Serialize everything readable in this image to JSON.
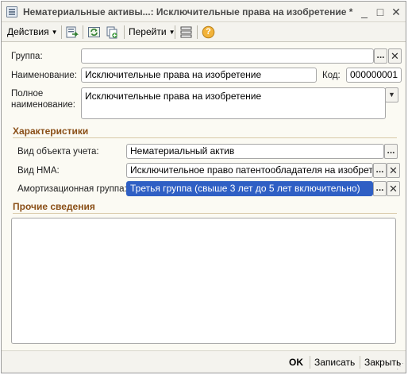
{
  "window": {
    "title": "Нематериальные активы...: Исключительные права на изобретение *",
    "minimize": "_",
    "maximize": "□",
    "close": "✕"
  },
  "toolbar": {
    "actions_label": "Действия",
    "goto_label": "Перейти",
    "help_label": "?"
  },
  "form": {
    "group_label": "Группа:",
    "group_value": "",
    "name_label": "Наименование:",
    "name_value": "Исключительные права на изобретение",
    "code_label": "Код:",
    "code_value": "000000001",
    "fullname_label_1": "Полное",
    "fullname_label_2": "наименование:",
    "fullname_value": "Исключительные права на изобретение"
  },
  "characteristics": {
    "title": "Характеристики",
    "object_type_label": "Вид объекта учета:",
    "object_type_value": "Нематериальный актив",
    "nma_type_label": "Вид НМА:",
    "nma_type_value": "Исключительное право патентообладателя на изобретение",
    "amort_group_label": "Амортизационная группа:",
    "amort_group_value": "Третья группа (свыше 3 лет до 5 лет включительно)"
  },
  "other": {
    "title": "Прочие сведения",
    "memo_value": ""
  },
  "footer": {
    "ok_label": "OK",
    "save_label": "Записать",
    "close_label": "Закрыть"
  },
  "glyphs": {
    "ellipsis": "...",
    "clear": "✕",
    "dropdown": "▼",
    "grip": "⋰"
  }
}
